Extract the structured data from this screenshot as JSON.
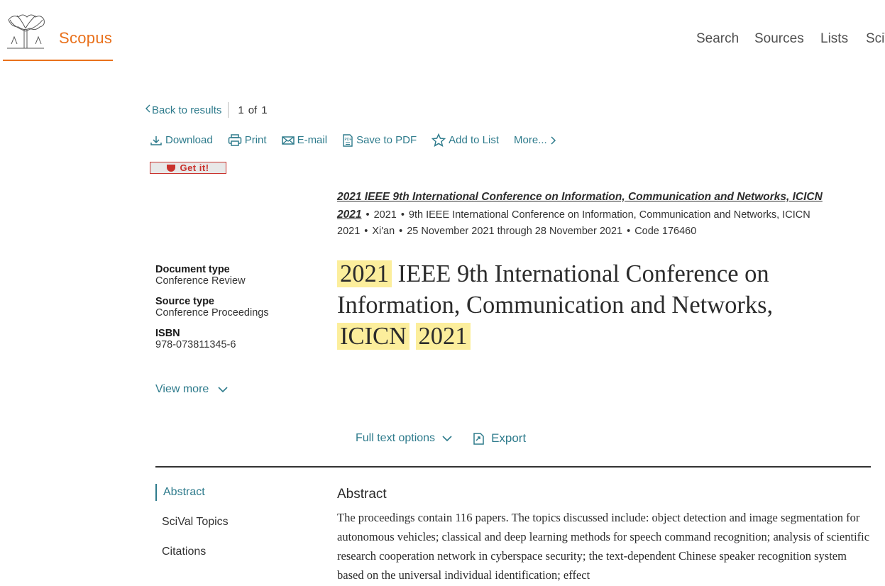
{
  "header": {
    "brand": "Scopus",
    "nav": [
      "Search",
      "Sources",
      "Lists",
      "SciV"
    ]
  },
  "toolbar": {
    "back_label": "Back to results",
    "position": "1",
    "of_label": "of",
    "total": "1",
    "tools": [
      "Download",
      "Print",
      "E-mail",
      "Save to PDF",
      "Add to List",
      "More..."
    ],
    "getit_label": "Get it!"
  },
  "source": {
    "title": "2021 IEEE 9th International Conference on Information, Communication and Networks, ICICN 2021",
    "year": "2021",
    "conference": "9th IEEE International Conference on Information, Communication and Networks, ICICN 2021",
    "location": "Xi'an",
    "dates": "25 November 2021 through 28 November 2021",
    "code": "Code 176460"
  },
  "meta": {
    "doc_type_label": "Document type",
    "doc_type": "Conference Review",
    "source_type_label": "Source type",
    "source_type": "Conference Proceedings",
    "isbn_label": "ISBN",
    "isbn": "978-073811345-6",
    "view_more": "View more"
  },
  "document": {
    "t1": "2021",
    "t2": " IEEE 9th International Conference on Information, Communication and Networks, ",
    "t3": "ICICN",
    "t4": "2021"
  },
  "actions": {
    "full_text": "Full text options",
    "export": "Export"
  },
  "sidenav": [
    "Abstract",
    "SciVal Topics",
    "Citations"
  ],
  "abstract": {
    "heading": "Abstract",
    "text": "The proceedings contain 116 papers. The topics discussed include: object detection and image segmentation for autonomous vehicles; classical and deep learning methods for speech command recognition; analysis of scientific research cooperation network in cyberspace security; the text-dependent Chinese speaker recognition system based on the universal individual identification; effect"
  },
  "colors": {
    "brand": "#e9711c",
    "link": "#2e7b8c",
    "highlight": "#fcee9c"
  }
}
